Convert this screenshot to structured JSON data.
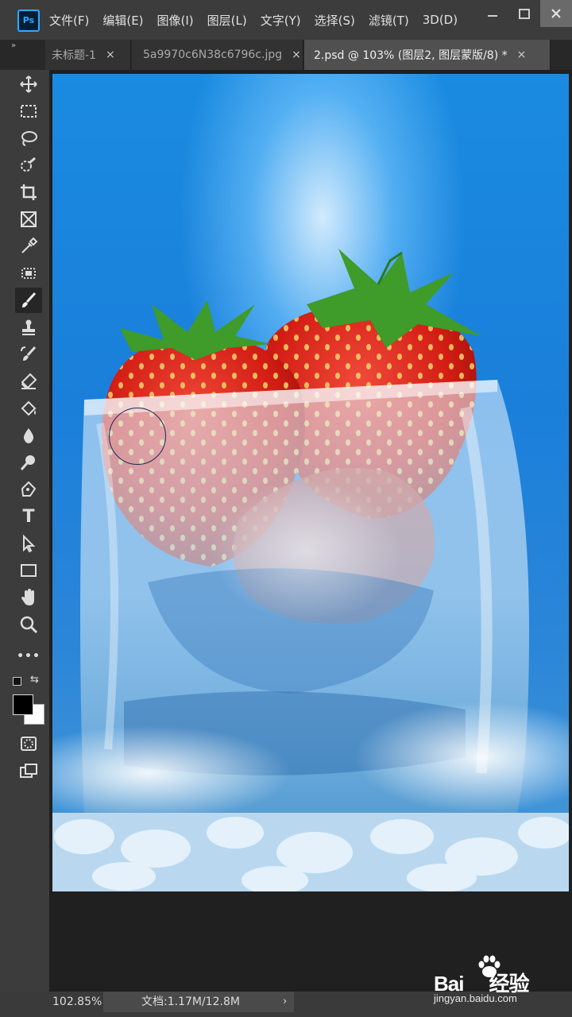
{
  "app": {
    "logo": "Ps",
    "menu": [
      "文件(F)",
      "编辑(E)",
      "图像(I)",
      "图层(L)",
      "文字(Y)",
      "选择(S)",
      "滤镜(T)",
      "3D(D)"
    ],
    "window_controls": [
      "minimize-icon",
      "maximize-icon",
      "close-icon"
    ]
  },
  "tabs": [
    {
      "label": "未标题-1",
      "close": "×",
      "active": false
    },
    {
      "label": "5a9970c6N38c6796c.jpg",
      "close": "×",
      "active": false
    },
    {
      "label": "2.psd @ 103% (图层2, 图层蒙版/8) *",
      "close": "×",
      "active": true
    }
  ],
  "tabbar": {
    "collapse_glyph": "»"
  },
  "toolbar": {
    "tools": [
      "move-icon",
      "marquee-icon",
      "lasso-icon",
      "quick-selection-icon",
      "crop-icon",
      "frame-icon",
      "eyedropper-icon",
      "patch-icon",
      "brush-icon",
      "stamp-icon",
      "history-brush-icon",
      "eraser-icon",
      "paint-bucket-icon",
      "blur-icon",
      "dodge-icon",
      "pen-icon",
      "type-icon",
      "path-selection-icon",
      "rectangle-icon",
      "hand-icon",
      "zoom-icon",
      "more-tools-icon"
    ],
    "active_tool": "brush-icon",
    "type_tool_glyph": "T",
    "more_glyph": "•••",
    "swap_glyph": "⇆",
    "foreground_color": "#000000",
    "background_color": "#ffffff",
    "extra": [
      "quick-mask-icon",
      "screen-mode-icon"
    ]
  },
  "status": {
    "zoom": "102.85%",
    "doc_info": "文档:1.17M/12.8M",
    "arrow": "›"
  },
  "watermark": {
    "main_left": "Bai",
    "main_right": "经验",
    "sub": "jingyan.baidu.com"
  }
}
